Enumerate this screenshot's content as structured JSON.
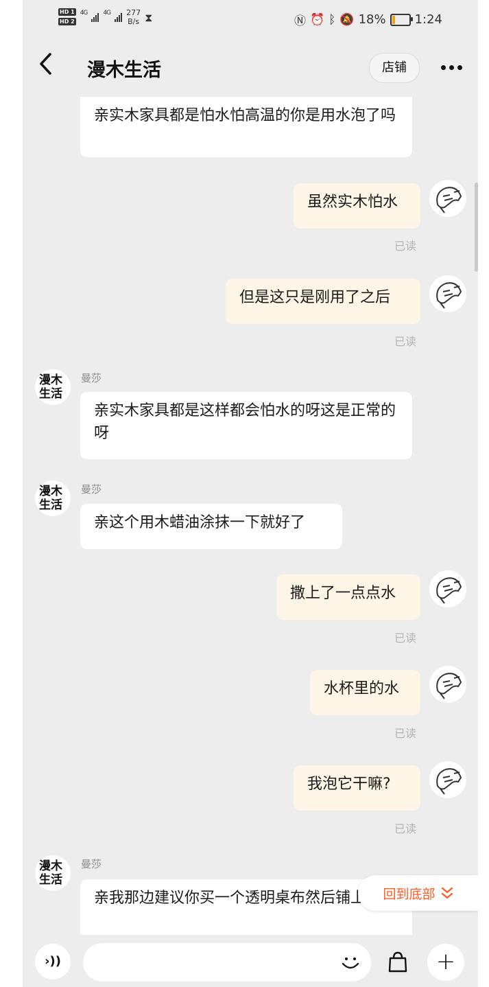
{
  "status_bar": {
    "hd1": "HD 1",
    "hd2": "HD 2",
    "net1": "4G",
    "net2": "4G",
    "speed_value": "277",
    "speed_unit": "B/s",
    "battery_text": "18%",
    "battery_level": 0.18,
    "time": "1:24",
    "battery_color": "#f0a11c"
  },
  "header": {
    "back_icon": "chevron-left-icon",
    "title": "漫木生活",
    "shop_button": "店铺",
    "more_icon": "more-horizontal-icon"
  },
  "messages": [
    {
      "from": "shop",
      "text": "亲实木家具都是怕水怕高温的你是用水泡了吗"
    },
    {
      "from": "me",
      "text": "虽然实木怕水",
      "status": "已读"
    },
    {
      "from": "me",
      "text": "但是这只是刚用了之后",
      "status": "已读"
    },
    {
      "from": "shop",
      "sender": "曼莎",
      "text": "亲实木家具都是这样都会怕水的呀这是正常的呀"
    },
    {
      "from": "shop",
      "sender": "曼莎",
      "text": "亲这个用木蜡油涂抹一下就好了"
    },
    {
      "from": "me",
      "text": "撒上了一点点水",
      "status": "已读"
    },
    {
      "from": "me",
      "text": "水杯里的水",
      "status": "已读"
    },
    {
      "from": "me",
      "text": "我泡它干嘛?",
      "status": "已读"
    },
    {
      "from": "shop",
      "sender": "曼莎",
      "text": "亲我那边建议你买一个透明桌布然后铺上哈"
    }
  ],
  "shop_avatar": {
    "line1": "漫木",
    "line2": "生活"
  },
  "back_to_bottom": {
    "label": "回到底部",
    "icon": "double-chevron-down-icon",
    "color": "#ff5a1f"
  },
  "input_bar": {
    "voice_icon": "voice-icon",
    "voice_label": "›))",
    "placeholder": "",
    "emoji_icon": "smiley-icon",
    "bag_icon": "shopping-bag-icon",
    "plus_icon": "plus-icon",
    "plus_label": "+"
  },
  "colors": {
    "incoming_bubble": "#ffffff",
    "outgoing_bubble": "#fdf6e6",
    "background": "#ededed"
  }
}
